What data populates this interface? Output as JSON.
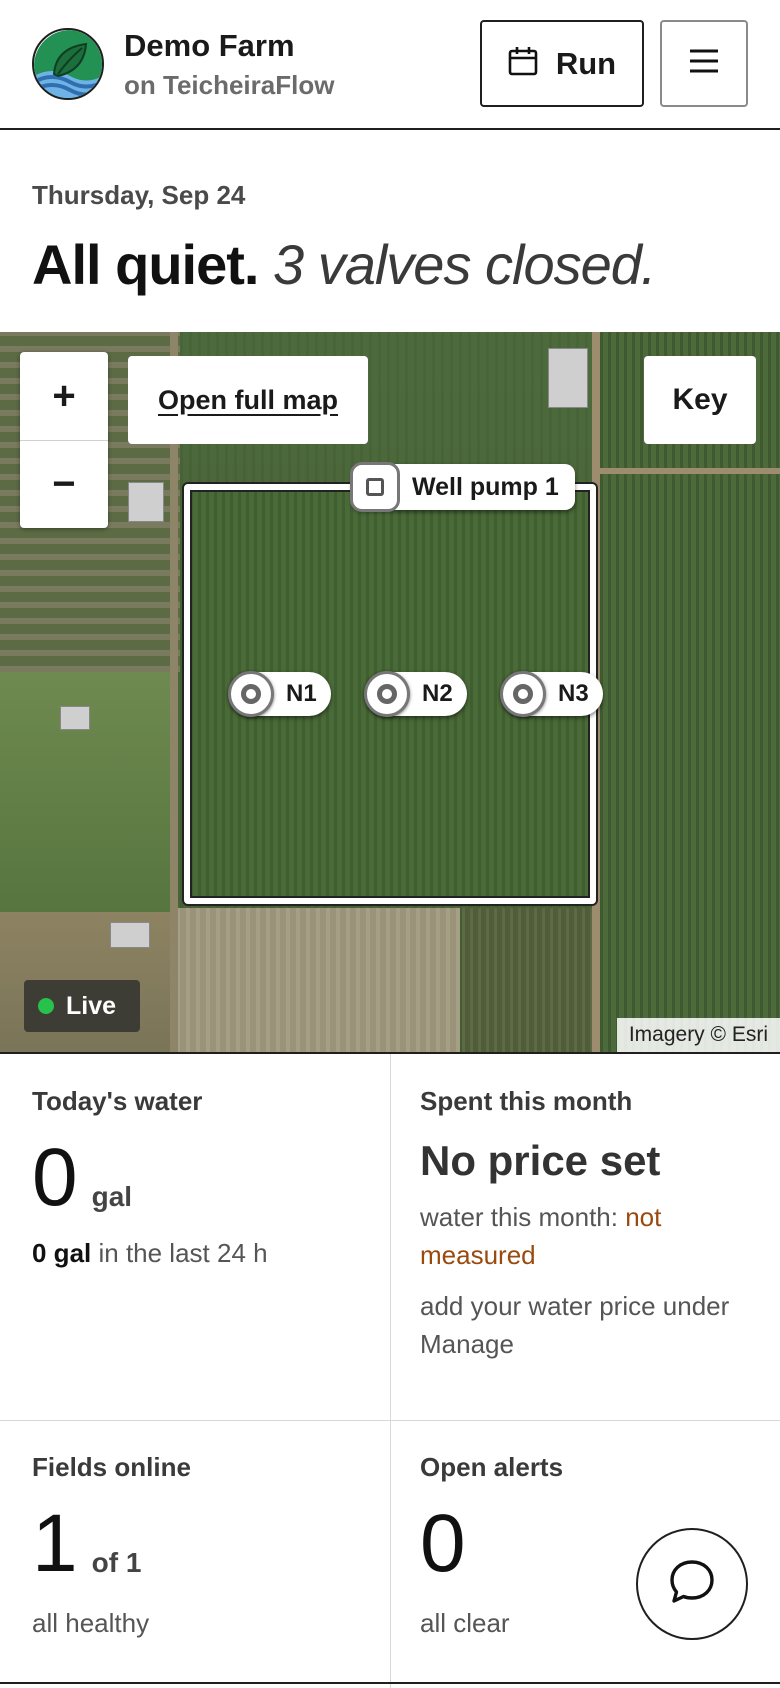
{
  "header": {
    "farm_name": "Demo Farm",
    "farm_sub": "on TeicheiraFlow",
    "run_label": "Run"
  },
  "summary": {
    "date": "Thursday, Sep 24",
    "status_strong": "All quiet.",
    "status_soft": "3 valves closed."
  },
  "map": {
    "zoom_in": "+",
    "zoom_out": "−",
    "open_full_map": "Open full map",
    "key_label": "Key",
    "pump_label": "Well pump 1",
    "nodes": [
      "N1",
      "N2",
      "N3"
    ],
    "live_label": "Live",
    "credit": "Imagery © Esri"
  },
  "stats": {
    "water": {
      "title": "Today's water",
      "value": "0",
      "unit": "gal",
      "sub_strong": "0 gal",
      "sub_rest": "in the last 24 h"
    },
    "spent": {
      "title": "Spent this month",
      "value": "No price set",
      "line1_prefix": "water this month:",
      "line1_accent": "not measured",
      "line2": "add your water price under Manage"
    },
    "fields": {
      "title": "Fields online",
      "value": "1",
      "unit": "of 1",
      "sub": "all healthy"
    },
    "alerts": {
      "title": "Open alerts",
      "value": "0",
      "sub": "all clear"
    }
  },
  "colors": {
    "accent": "#9a4a0e",
    "live_dot": "#27c24c",
    "logo_green": "#2e8b57",
    "logo_blue": "#4f8fd0"
  }
}
